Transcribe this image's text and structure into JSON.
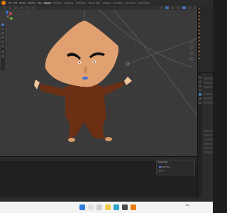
{
  "menubar": {
    "items": [
      "File",
      "Edit",
      "Render",
      "Window",
      "Help"
    ],
    "workspaces": [
      "Layout",
      "Modeling",
      "Sculpting",
      "UV Editing",
      "Texture Paint",
      "Shading",
      "Animation",
      "Rendering",
      "Compositing"
    ],
    "active_workspace": "Layout"
  },
  "viewport": {
    "background_color": "#3a3a3a",
    "character": {
      "head_color": "#e0a070",
      "body_color": "#6b2f14",
      "skin_color": "#f0c79a",
      "shoe_color": "#d79a6a"
    },
    "gizmo_colors": {
      "x": "#e34b4b",
      "y": "#6fbe3e",
      "z": "#3f7fe5"
    }
  },
  "undo_panel": {
    "title": "Select Box",
    "checkbox_label": "Select Box"
  },
  "taskbar": {
    "language": "ENG",
    "time": "",
    "icons": [
      "windows-icon",
      "search-icon",
      "taskview-icon",
      "explorer-icon",
      "edge-icon",
      "store-icon",
      "blender-icon"
    ]
  }
}
